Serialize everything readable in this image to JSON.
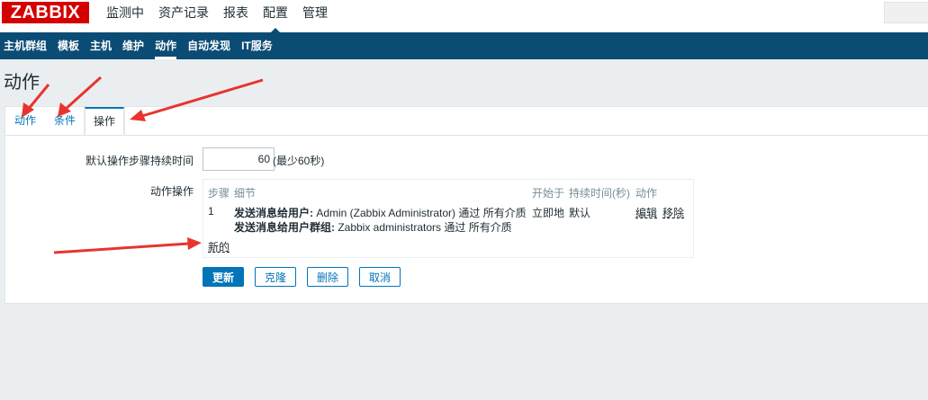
{
  "header": {
    "logo": "ZABBIX",
    "menu": [
      "监测中",
      "资产记录",
      "报表",
      "配置",
      "管理"
    ],
    "selected_menu": "配置"
  },
  "submenu": {
    "items": [
      "主机群组",
      "模板",
      "主机",
      "维护",
      "动作",
      "自动发现",
      "IT服务"
    ],
    "selected": "动作"
  },
  "page": {
    "title": "动作"
  },
  "tabs": [
    "动作",
    "条件",
    "操作"
  ],
  "active_tab": "操作",
  "form": {
    "duration_label": "默认操作步骤持续时间",
    "duration_value": "60",
    "duration_hint": "(最少60秒)",
    "operations_label": "动作操作",
    "operations": {
      "headers": [
        "步骤",
        "细节",
        "开始于",
        "持续时间(秒)",
        "动作"
      ],
      "rows": [
        {
          "step": "1",
          "detail_line1_bold": "发送消息给用户:",
          "detail_line1_rest": " Admin (Zabbix Administrator) 通过 所有介质",
          "detail_line2_bold": "发送消息给用户群组:",
          "detail_line2_rest": " Zabbix administrators 通过 所有介质",
          "start_in": "立即地",
          "duration": "默认",
          "edit": "编辑",
          "remove": "移除"
        }
      ],
      "new_link": "新的"
    },
    "buttons": {
      "update": "更新",
      "clone": "克隆",
      "delete": "删除",
      "cancel": "取消"
    }
  },
  "colors": {
    "brand_red": "#d40000",
    "nav_blue": "#0b4c75",
    "link_blue": "#0275b8",
    "annotation_red": "#e8342f"
  }
}
